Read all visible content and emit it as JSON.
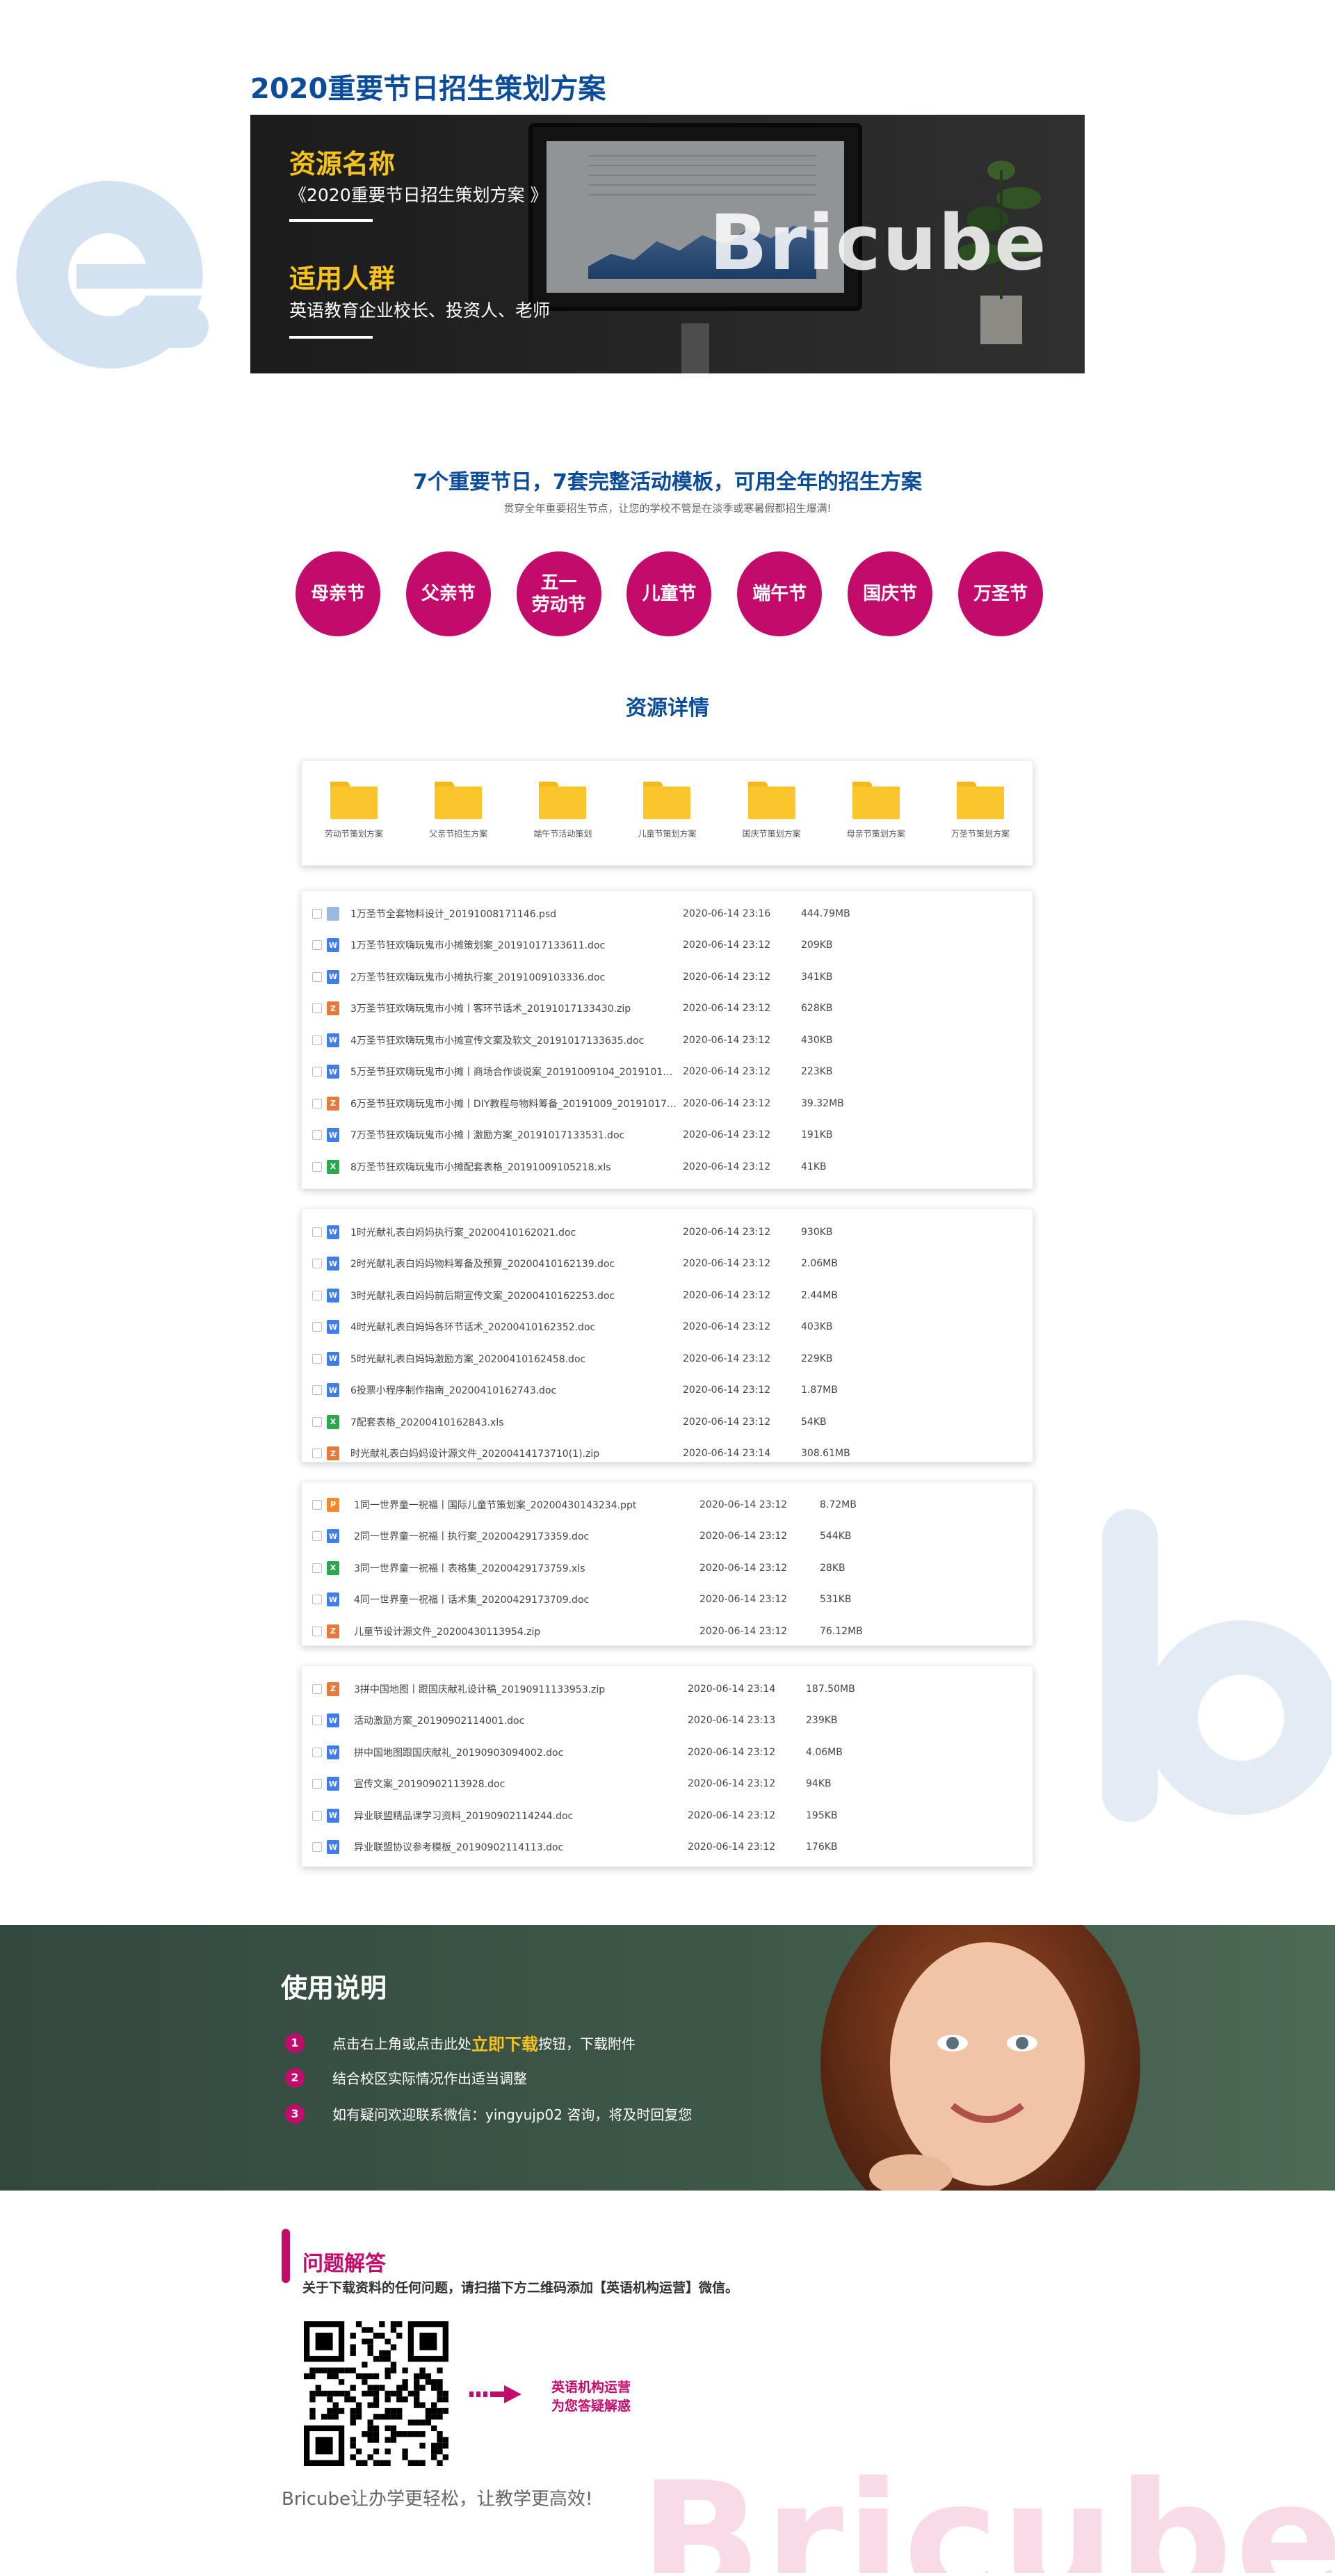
{
  "header": {
    "page_title": "2020重要节日招生策划方案",
    "banner_brand": "Bricube",
    "resource_label": "资源名称",
    "resource_value": "《2020重要节日招生策划方案 》",
    "audience_label": "适用人群",
    "audience_value": "英语教育企业校长、投资人、老师"
  },
  "intro": {
    "title": "7个重要节日，7套完整活动模板，可用全年的招生方案",
    "subtitle": "贯穿全年重要招生节点，让您的学校不管是在淡季或寒暑假都招生爆满!"
  },
  "holidays": [
    "母亲节",
    "父亲节",
    "五一\n劳动节",
    "儿童节",
    "端午节",
    "国庆节",
    "万圣节"
  ],
  "details_title": "资源详情",
  "folders": [
    "劳动节策划方案",
    "父亲节招生方案",
    "端午节活动策划",
    "儿童节策划方案",
    "国庆节策划方案",
    "母亲节策划方案",
    "万圣节策划方案"
  ],
  "file_groups": [
    [
      {
        "type": "psd",
        "name": "1万圣节全套物料设计_20191008171146.psd",
        "date": "2020-06-14 23:16",
        "size": "444.79MB"
      },
      {
        "type": "doc",
        "name": "1万圣节狂欢嗨玩鬼市小摊策划案_20191017133611.doc",
        "date": "2020-06-14 23:12",
        "size": "209KB"
      },
      {
        "type": "doc",
        "name": "2万圣节狂欢嗨玩鬼市小摊执行案_20191009103336.doc",
        "date": "2020-06-14 23:12",
        "size": "341KB"
      },
      {
        "type": "zip",
        "name": "3万圣节狂欢嗨玩鬼市小摊丨客环节话术_20191017133430.zip",
        "date": "2020-06-14 23:12",
        "size": "628KB"
      },
      {
        "type": "doc",
        "name": "4万圣节狂欢嗨玩鬼市小摊宣传文案及软文_20191017133635.doc",
        "date": "2020-06-14 23:12",
        "size": "430KB"
      },
      {
        "type": "doc",
        "name": "5万圣节狂欢嗨玩鬼市小摊丨商场合作谈说案_20191009104_20191017133...",
        "date": "2020-06-14 23:12",
        "size": "223KB"
      },
      {
        "type": "zip",
        "name": "6万圣节狂欢嗨玩鬼市小摊丨DIY教程与物料筹备_20191009_20191017133...",
        "date": "2020-06-14 23:12",
        "size": "39.32MB"
      },
      {
        "type": "doc",
        "name": "7万圣节狂欢嗨玩鬼市小摊丨激励方案_20191017133531.doc",
        "date": "2020-06-14 23:12",
        "size": "191KB"
      },
      {
        "type": "xls",
        "name": "8万圣节狂欢嗨玩鬼市小摊配套表格_20191009105218.xls",
        "date": "2020-06-14 23:12",
        "size": "41KB"
      }
    ],
    [
      {
        "type": "doc",
        "name": "1时光献礼表白妈妈执行案_20200410162021.doc",
        "date": "2020-06-14 23:12",
        "size": "930KB"
      },
      {
        "type": "doc",
        "name": "2时光献礼表白妈妈物料筹备及预算_20200410162139.doc",
        "date": "2020-06-14 23:12",
        "size": "2.06MB"
      },
      {
        "type": "doc",
        "name": "3时光献礼表白妈妈前后期宣传文案_20200410162253.doc",
        "date": "2020-06-14 23:12",
        "size": "2.44MB"
      },
      {
        "type": "doc",
        "name": "4时光献礼表白妈妈各环节话术_20200410162352.doc",
        "date": "2020-06-14 23:12",
        "size": "403KB"
      },
      {
        "type": "doc",
        "name": "5时光献礼表白妈妈激励方案_20200410162458.doc",
        "date": "2020-06-14 23:12",
        "size": "229KB"
      },
      {
        "type": "doc",
        "name": "6投票小程序制作指南_20200410162743.doc",
        "date": "2020-06-14 23:12",
        "size": "1.87MB"
      },
      {
        "type": "xls",
        "name": "7配套表格_20200410162843.xls",
        "date": "2020-06-14 23:12",
        "size": "54KB"
      },
      {
        "type": "zip",
        "name": "时光献礼表白妈妈设计源文件_20200414173710(1).zip",
        "date": "2020-06-14 23:14",
        "size": "308.61MB"
      }
    ],
    [
      {
        "type": "ppt",
        "name": "1同一世界童一祝福丨国际儿童节策划案_20200430143234.ppt",
        "date": "2020-06-14 23:12",
        "size": "8.72MB"
      },
      {
        "type": "doc",
        "name": "2同一世界童一祝福丨执行案_20200429173359.doc",
        "date": "2020-06-14 23:12",
        "size": "544KB"
      },
      {
        "type": "xls",
        "name": "3同一世界童一祝福丨表格集_20200429173759.xls",
        "date": "2020-06-14 23:12",
        "size": "28KB"
      },
      {
        "type": "doc",
        "name": "4同一世界童一祝福丨话术集_20200429173709.doc",
        "date": "2020-06-14 23:12",
        "size": "531KB"
      },
      {
        "type": "zip",
        "name": "儿童节设计源文件_20200430113954.zip",
        "date": "2020-06-14 23:12",
        "size": "76.12MB"
      }
    ],
    [
      {
        "type": "zip",
        "name": "3拼中国地图丨跟国庆献礼设计稿_20190911133953.zip",
        "date": "2020-06-14 23:14",
        "size": "187.50MB"
      },
      {
        "type": "doc",
        "name": "活动激励方案_20190902114001.doc",
        "date": "2020-06-14 23:13",
        "size": "239KB"
      },
      {
        "type": "doc",
        "name": "拼中国地图跟国庆献礼_20190903094002.doc",
        "date": "2020-06-14 23:12",
        "size": "4.06MB"
      },
      {
        "type": "doc",
        "name": "宣传文案_20190902113928.doc",
        "date": "2020-06-14 23:12",
        "size": "94KB"
      },
      {
        "type": "doc",
        "name": "异业联盟精品课学习资料_20190902114244.doc",
        "date": "2020-06-14 23:12",
        "size": "195KB"
      },
      {
        "type": "doc",
        "name": "异业联盟协议参考模板_20190902114113.doc",
        "date": "2020-06-14 23:12",
        "size": "176KB"
      }
    ]
  ],
  "icons": {
    "doc": "W",
    "xls": "X",
    "zip": "Z",
    "psd": "",
    "ppt": "P"
  },
  "usage": {
    "title": "使用说明",
    "steps": [
      {
        "num": "1",
        "pre": "点击右上角或点击此处",
        "highlight": "立即下载",
        "post": "按钮，下载附件"
      },
      {
        "num": "2",
        "pre": "结合校区实际情况作出适当调整",
        "highlight": "",
        "post": ""
      },
      {
        "num": "3",
        "pre": "如有疑问欢迎联系微信：yingyujp02 咨询，将及时回复您",
        "highlight": "",
        "post": ""
      }
    ]
  },
  "qa": {
    "title": "问题解答",
    "desc": "关于下载资料的任何问题，请扫描下方二维码添加【英语机构运营】微信。",
    "side_line1": "英语机构运营",
    "side_line2": "为您答疑解惑",
    "slogan": "Bricube让办学更轻松，让教学更高效!"
  },
  "colors": {
    "brand_blue": "#0a4c9a",
    "magenta": "#c20b6b",
    "gold": "#f7c21a",
    "folder_yellow": "#fbc62c",
    "usage_green": "#3e5848"
  }
}
